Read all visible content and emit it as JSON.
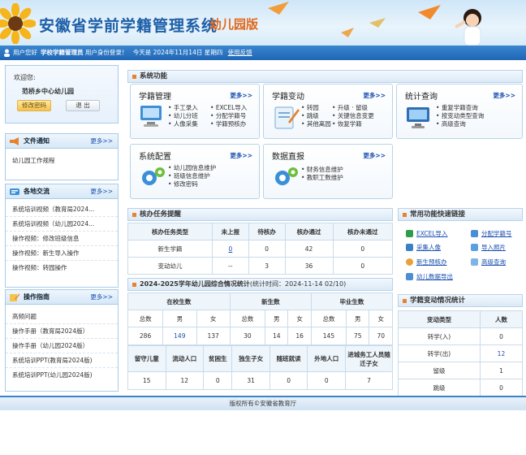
{
  "header": {
    "title": "安徽省学前学籍管理系统",
    "subtitle": "幼儿园版"
  },
  "infobar": {
    "greeting": "用户您好",
    "role": "学校学籍管理员",
    "identity": "用户身份登录！",
    "today": "今天是 2024年11月14日 星期四",
    "feedback": "使用反馈"
  },
  "welcome": {
    "label": "欢迎您:",
    "school": "范桥乡中心幼儿园",
    "change_pwd": "修改密码",
    "logout": "退 出"
  },
  "notice": {
    "title": "文件通知",
    "more": "更多>>",
    "items": [
      "幼儿园工作规程"
    ]
  },
  "exchange": {
    "title": "各地交流",
    "more": "更多>>",
    "items": [
      "系统培训视频（教育局2024...",
      "系统培训视频（幼儿园2024...",
      "操作视频：修改班级信息",
      "操作视频：新生导入操作",
      "操作视频：转园操作"
    ]
  },
  "guide": {
    "title": "操作指南",
    "more": "更多>>",
    "items": [
      "高频问题",
      "操作手册（教育局2024版）",
      "操作手册（幼儿园2024版）",
      "系统培训PPT(教育局2024版)",
      "系统培训PPT(幼儿园2024版)"
    ]
  },
  "functions": {
    "title": "系统功能",
    "cards": [
      {
        "title": "学籍管理",
        "more": "更多>>",
        "items_col1": [
          "手工录入",
          "幼儿分班",
          "人像采集"
        ],
        "items_col2": [
          "EXCEL导入",
          "分配学籍号",
          "学籍预核办"
        ]
      },
      {
        "title": "学籍变动",
        "more": "更多>>",
        "items_col1": [
          "转园",
          "跳级",
          "其他离园"
        ],
        "items_col2": [
          "升级",
          "关键信息变更",
          "恢复学籍"
        ],
        "extra": "留级"
      },
      {
        "title": "统计查询",
        "more": "更多>>",
        "items_col1": [
          "重复学籍查询",
          "按变动类型查询",
          "高级查询"
        ]
      },
      {
        "title": "系统配置",
        "more": "更多>>",
        "items_col1": [
          "幼儿园信息维护",
          "班级信息维护",
          "修改密码"
        ]
      },
      {
        "title": "数据直报",
        "more": "更多>>",
        "items_col1": [
          "财务信息维护",
          "教职工数维护"
        ]
      }
    ]
  },
  "tasks": {
    "title": "核办任务提醒",
    "headers": [
      "核办任务类型",
      "未上报",
      "待核办",
      "核办通过",
      "核办未通过"
    ],
    "rows": [
      [
        "新生学籍",
        "0",
        "0",
        "42",
        "0"
      ],
      [
        "变动幼儿",
        "--",
        "3",
        "36",
        "0"
      ]
    ]
  },
  "summary": {
    "title": "2024-2025学年幼儿园综合情况统计",
    "time": "(统计时间：2024-11-14 02/10)",
    "groups": [
      "在校生数",
      "新生数",
      "毕业生数"
    ],
    "sub": [
      "总数",
      "男",
      "女",
      "总数",
      "男",
      "女",
      "总数",
      "男",
      "女"
    ],
    "values": [
      "286",
      "149",
      "137",
      "30",
      "14",
      "16",
      "145",
      "75",
      "70"
    ],
    "headers2": [
      "留守儿童",
      "流动人口",
      "贫困生",
      "独生子女",
      "随班就读",
      "外地人口",
      "进城务工人员随迁子女"
    ],
    "values2": [
      "15",
      "12",
      "0",
      "31",
      "0",
      "0",
      "7"
    ]
  },
  "quick": {
    "title": "常用功能快速链接",
    "items": [
      "EXCEL导入",
      "分配学籍号",
      "采集人像",
      "导入照片",
      "新生预核办",
      "高级查询",
      "幼儿数据导出"
    ]
  },
  "changes": {
    "title": "学籍变动情况统计",
    "headers": [
      "变动类型",
      "人数"
    ],
    "rows": [
      [
        "转学(入)",
        "0"
      ],
      [
        "转学(出)",
        "12"
      ],
      [
        "留级",
        "1"
      ],
      [
        "跳级",
        "0"
      ]
    ]
  },
  "footer": {
    "text": "版权所有©安徽省教育厅"
  }
}
